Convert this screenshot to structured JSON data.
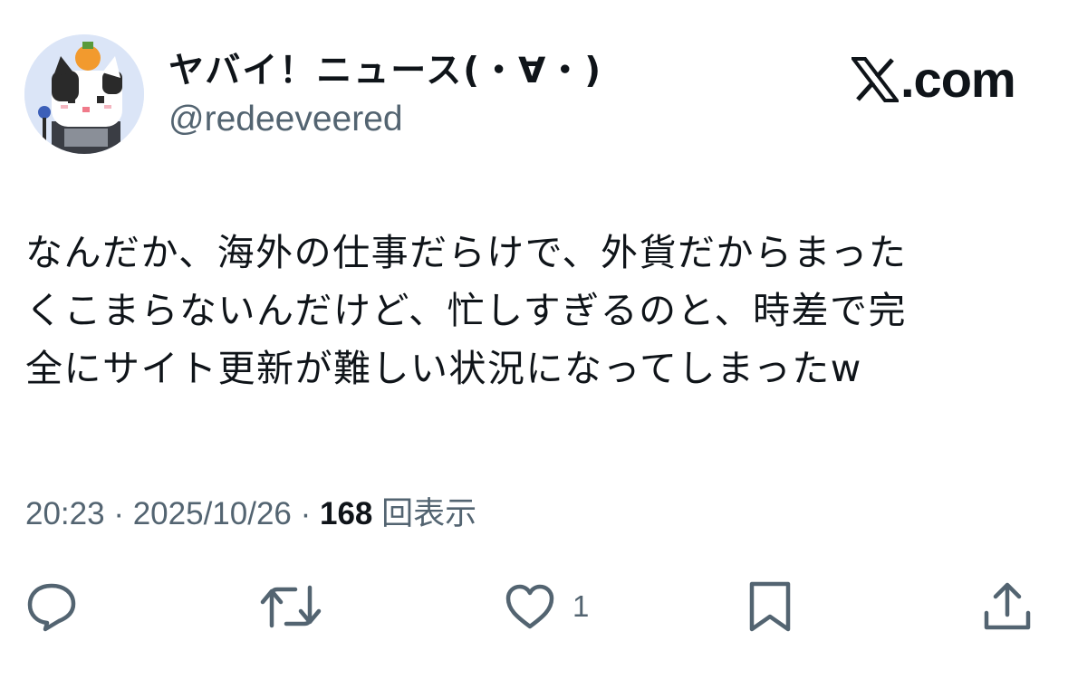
{
  "author": {
    "display_name": "ヤバイ！ニュース(・∀・)",
    "handle": "@redeeveered",
    "avatar_icon": "cat-avatar-icon"
  },
  "site": {
    "logo_icon": "x-logo-icon",
    "domain_suffix": ".com"
  },
  "tweet": {
    "text": "なんだか、海外の仕事だらけで、外貨だからまった\nくこまらないんだけど、忙しすぎるのと、時差で完\n全にサイト更新が難しい状況になってしまったw"
  },
  "meta": {
    "time": "20:23",
    "separator1": " · ",
    "date": "2025/10/26",
    "separator2": " · ",
    "views": "168",
    "views_label": "回表示"
  },
  "actions": {
    "like_count": "1",
    "icons": [
      "reply-icon",
      "retweet-icon",
      "like-icon",
      "bookmark-icon",
      "share-icon"
    ],
    "icon_color": "#536471"
  }
}
